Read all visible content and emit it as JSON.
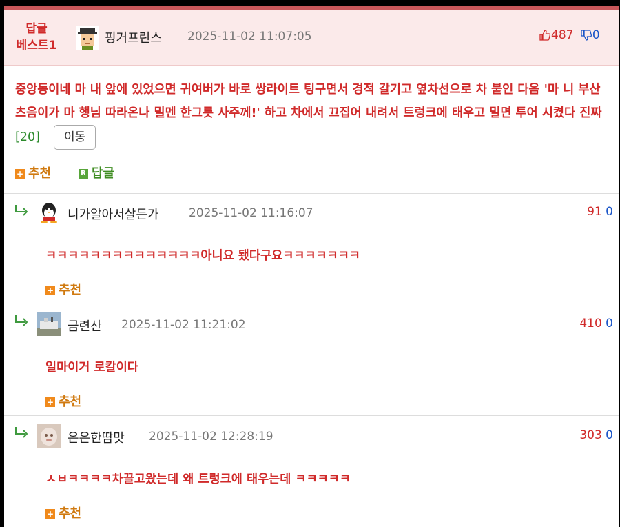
{
  "best": {
    "badge_line1": "답글",
    "badge_line2": "베스트1",
    "name": "핑거프린스",
    "date": "2025-11-02 11:07:05",
    "up": "487",
    "down": "0",
    "text": "중앙동이네 마 내 앞에 있었으면 귀여버가 바로 쌍라이트 팅구면서 경적 갈기고 옆차선으로 차 붙인 다음 '마 니 부산 츠음이가 마 행님 따라온나 밀멘 한그릇 사주께!' 하고 차에서 끄집어 내려서 트렁크에 태우고 밀면 투어 시켰다 진짜",
    "reply_count": "[20]",
    "move_label": "이동",
    "recommend_label": "추천",
    "reply_label": "답글"
  },
  "comments": [
    {
      "name": "니가알아서살든가",
      "date": "2025-11-02 11:16:07",
      "up": "91",
      "down": "0",
      "text": "ㅋㅋㅋㅋㅋㅋㅋㅋㅋㅋㅋㅋㅋㅋ아니요 됐다구요ㅋㅋㅋㅋㅋㅋㅋ",
      "recommend_label": "추천"
    },
    {
      "name": "금련산",
      "date": "2025-11-02 11:21:02",
      "up": "410",
      "down": "0",
      "text": "일마이거 로칼이다",
      "recommend_label": "추천"
    },
    {
      "name": "은은한땀맛",
      "date": "2025-11-02 12:28:19",
      "up": "303",
      "down": "0",
      "text": "ㅅㅂㅋㅋㅋㅋ차끌고왔는데 왜 트렁크에 태우는데 ㅋㅋㅋㅋㅋ",
      "recommend_label": "추천"
    }
  ],
  "icons": {
    "thumbs_up": "thumbs-up-icon",
    "thumbs_down": "thumbs-down-icon",
    "reply_arrow": "reply-arrow-icon",
    "plus": "plus-icon"
  },
  "colors": {
    "accent_red": "#d02a2a",
    "down_blue": "#1a55c8",
    "recommend_orange": "#f08a1c",
    "reply_green": "#58a53a",
    "best_header_bg": "#fbeaea"
  }
}
